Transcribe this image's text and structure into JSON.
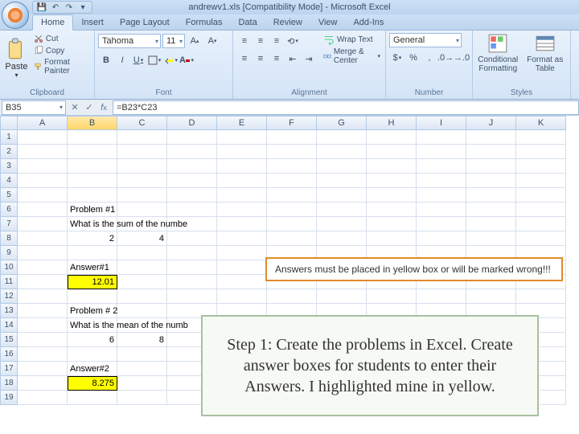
{
  "title": "andrewv1.xls [Compatibility Mode] - Microsoft Excel",
  "qat": {
    "save": "💾",
    "undo": "↶",
    "redo": "↷"
  },
  "tabs": [
    "Home",
    "Insert",
    "Page Layout",
    "Formulas",
    "Data",
    "Review",
    "View",
    "Add-Ins"
  ],
  "clipboard": {
    "paste": "Paste",
    "cut": "Cut",
    "copy": "Copy",
    "fmt": "Format Painter",
    "title": "Clipboard"
  },
  "font": {
    "name": "Tahoma",
    "size": "11",
    "title": "Font",
    "bold": "B",
    "italic": "I",
    "under": "U"
  },
  "align": {
    "wrap": "Wrap Text",
    "merge": "Merge & Center",
    "title": "Alignment"
  },
  "number": {
    "combo": "General",
    "title": "Number"
  },
  "styles": {
    "cond": "Conditional Formatting",
    "table": "Format as Table",
    "title": "Styles"
  },
  "namebox": "B35",
  "formula": "=B23*C23",
  "cols": [
    "A",
    "B",
    "C",
    "D",
    "E",
    "F",
    "G",
    "H",
    "I",
    "J",
    "K"
  ],
  "rows": [
    "1",
    "2",
    "3",
    "4",
    "5",
    "6",
    "7",
    "8",
    "9",
    "10",
    "11",
    "12",
    "13",
    "14",
    "15",
    "16",
    "17",
    "18",
    "19"
  ],
  "cells": {
    "b6": "Problem #1",
    "b7": "What is the sum of the numbe",
    "b8": "2",
    "c8": "4",
    "b10": "Answer#1",
    "b11": "12.01",
    "b13": "Problem # 2",
    "b14": "What is the mean of the numb",
    "b15": "6",
    "c15": "8",
    "b17": "Answer#2",
    "b18": "8.275"
  },
  "banner1": "Answers must be placed in yellow box or will be marked wrong!!!",
  "banner2": "Step 1:  Create the problems in Excel. Create answer boxes for students to enter their Answers. I highlighted mine in yellow."
}
